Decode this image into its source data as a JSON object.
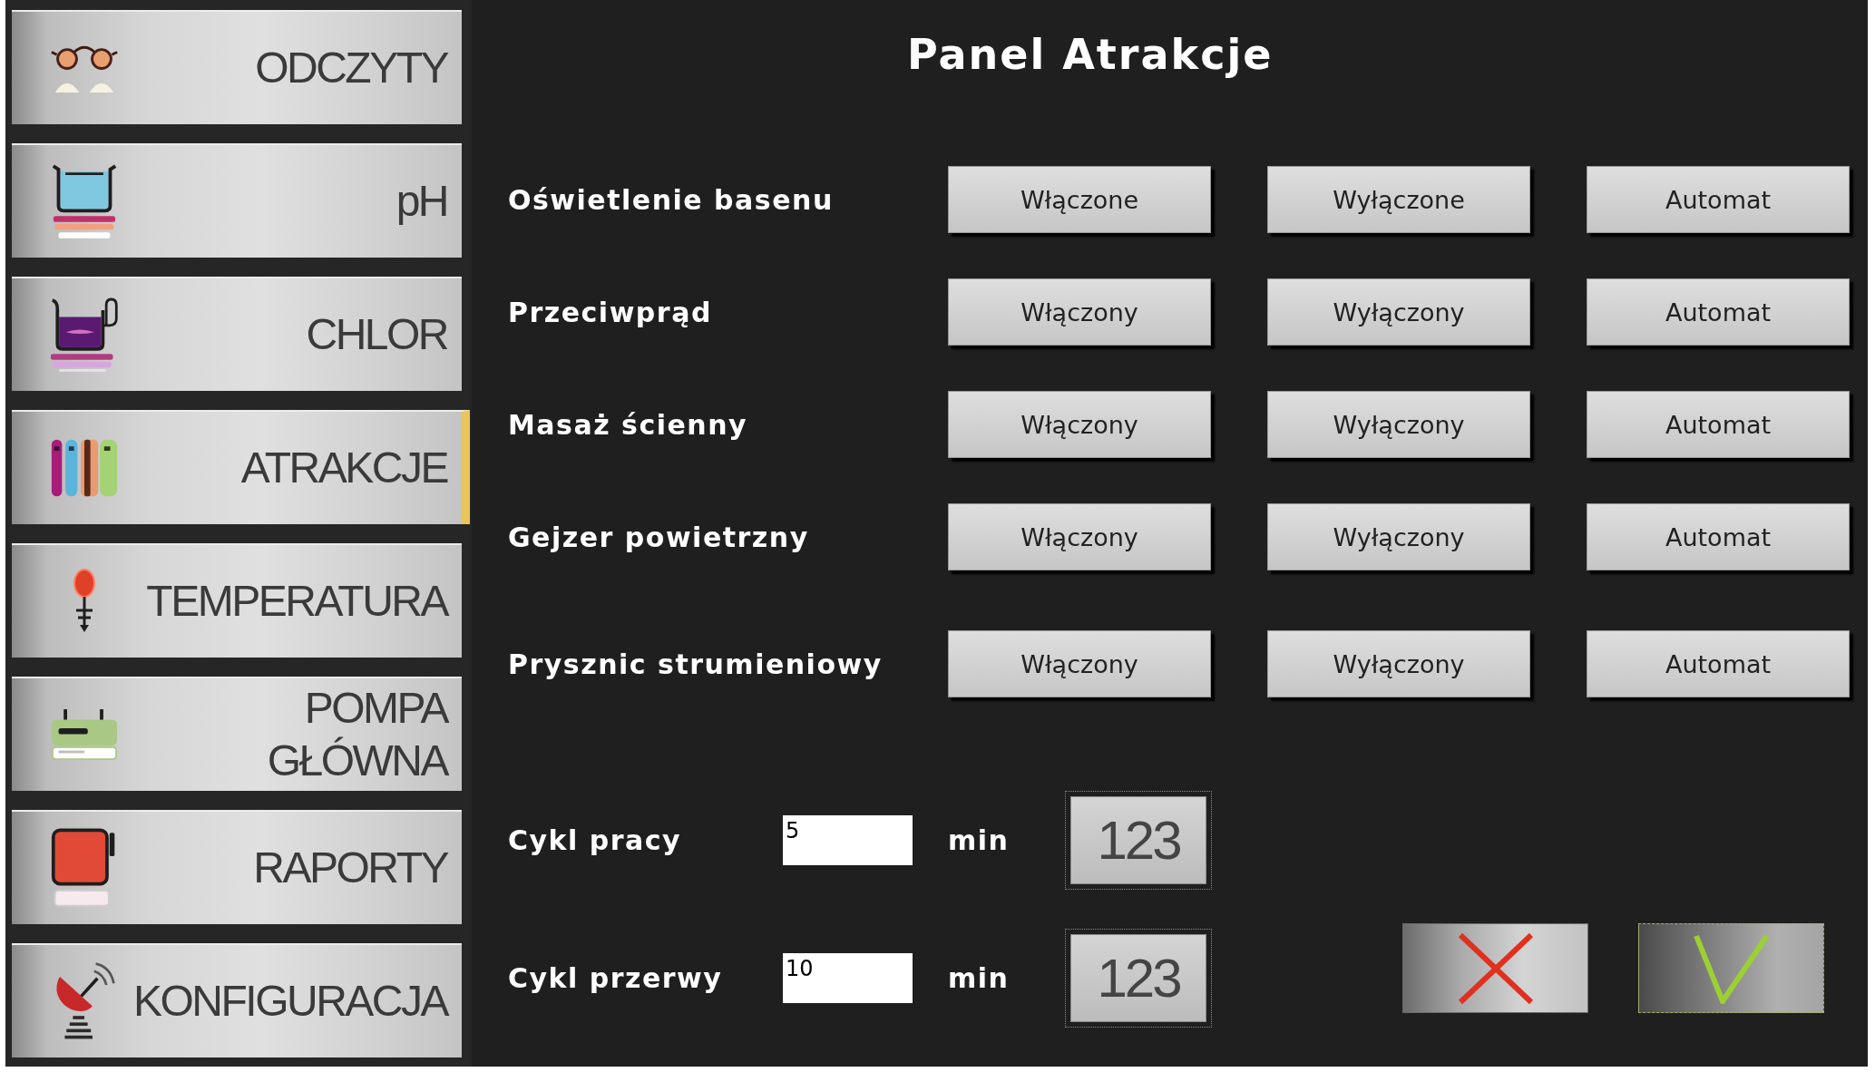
{
  "sidebar": {
    "items": [
      {
        "label": "ODCZYTY",
        "selected": false
      },
      {
        "label": "pH",
        "selected": false
      },
      {
        "label": "CHLOR",
        "selected": false
      },
      {
        "label": "ATRAKCJE",
        "selected": true
      },
      {
        "label": "TEMPERATURA",
        "selected": false
      },
      {
        "label": "POMPA GŁÓWNA",
        "selected": false
      },
      {
        "label": "RAPORTY",
        "selected": false
      },
      {
        "label": "KONFIGURACJA",
        "selected": false
      }
    ]
  },
  "panel": {
    "title": "Panel Atrakcje",
    "attractions": [
      {
        "name": "Oświetlenie basenu",
        "buttons": [
          "Włączone",
          "Wyłączone",
          "Automat"
        ]
      },
      {
        "name": "Przeciwprąd",
        "buttons": [
          "Włączony",
          "Wyłączony",
          "Automat"
        ]
      },
      {
        "name": "Masaż ścienny",
        "buttons": [
          "Włączony",
          "Wyłączony",
          "Automat"
        ]
      },
      {
        "name": "Gejzer powietrzny",
        "buttons": [
          "Włączony",
          "Wyłączony",
          "Automat"
        ]
      },
      {
        "name": "Prysznic strumieniowy",
        "buttons": [
          "Włączony",
          "Wyłączony",
          "Automat"
        ]
      }
    ],
    "cycles": [
      {
        "label": "Cykl pracy",
        "value": "5",
        "unit": "min",
        "keypad": "123"
      },
      {
        "label": "Cykl przerwy",
        "value": "10",
        "unit": "min",
        "keypad": "123"
      }
    ],
    "actions": [
      {
        "kind": "cancel"
      },
      {
        "kind": "confirm"
      }
    ]
  }
}
